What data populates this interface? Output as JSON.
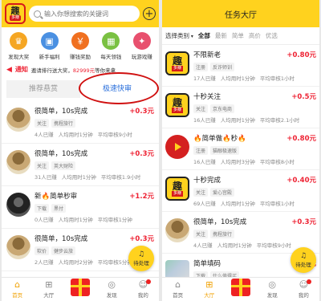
{
  "left": {
    "logo": {
      "char": "趣",
      "tag": "多赚"
    },
    "search": {
      "placeholder": "输入你想搜索的关键词"
    },
    "quick_items": [
      {
        "label": "发现大奖",
        "icon": "trophy-icon",
        "color": "#f5a623",
        "glyph": "♛"
      },
      {
        "label": "新手福利",
        "icon": "gift-icon",
        "color": "#4a90e2",
        "glyph": "▣"
      },
      {
        "label": "赚钱奖励",
        "icon": "coin-icon",
        "color": "#f07020",
        "glyph": "￥"
      },
      {
        "label": "每天领钱",
        "icon": "calendar-icon",
        "color": "#7ac142",
        "glyph": "▦"
      },
      {
        "label": "玩游戏赚",
        "icon": "game-icon",
        "color": "#e8506e",
        "glyph": "✦"
      }
    ],
    "notice": {
      "title": "通知",
      "prefix": "邀请排行送大奖，",
      "highlight": "82999元",
      "suffix": "等你来拿"
    },
    "tabs": [
      "推荐悬赏",
      "极速快审"
    ],
    "tasks": [
      {
        "title": "很简单，10s完成",
        "price": "+0.3元",
        "tags": [
          "关注",
          "携程旅行"
        ],
        "meta": [
          "4人已赚",
          "人均用时1分钟",
          "平均审核9小时"
        ],
        "avatar": "tree"
      },
      {
        "title": "很简单，10s完成",
        "price": "+0.3元",
        "tags": [
          "关注",
          "英大财险"
        ],
        "meta": [
          "31人已赚",
          "人均用时1分钟",
          "平均审核1.9小时"
        ],
        "avatar": "tree"
      },
      {
        "title": "新🔥简单秒审",
        "price": "+1.2元",
        "tags": [
          "下载",
          "黑付"
        ],
        "meta": [
          "0人已赚",
          "人均用时1分钟",
          "平均审核1分钟"
        ],
        "avatar": "dark"
      },
      {
        "title": "很简单，10s完成",
        "price": "+0.3元",
        "tags": [
          "软价",
          "健步云旅"
        ],
        "meta": [
          "2人已赚",
          "人均用时2分钟",
          "平均审核5分钟"
        ],
        "avatar": "tree"
      }
    ],
    "pending": "待处理",
    "nav": [
      {
        "label": "首页",
        "icon": "home-icon",
        "glyph": "⌂",
        "active": true
      },
      {
        "label": "大厅",
        "icon": "grid-icon",
        "glyph": "⊞",
        "active": false
      },
      {
        "label": "",
        "icon": "gift-box-icon",
        "glyph": "",
        "active": false
      },
      {
        "label": "发现",
        "icon": "compass-icon",
        "glyph": "◎",
        "active": false
      },
      {
        "label": "我的",
        "icon": "user-icon",
        "glyph": "☺",
        "active": false
      }
    ]
  },
  "right": {
    "title": "任务大厅",
    "filter_label": "选择类别",
    "filter_tabs": [
      "全部",
      "最新",
      "简单",
      "高价",
      "优选"
    ],
    "tasks": [
      {
        "title": "不限新老",
        "price": "+0.80元",
        "tags": [
          "注册",
          "反诈师训"
        ],
        "meta": [
          "17人已赚",
          "人均用时1分钟",
          "平均审核1小时"
        ],
        "avatar": "logo"
      },
      {
        "title": "十秒关注",
        "price": "+0.5元",
        "tags": [
          "关注",
          "京东电商"
        ],
        "meta": [
          "16人已赚",
          "人均用时1分钟",
          "平均审核2.1小时"
        ],
        "avatar": "logo"
      },
      {
        "title": "🔥简单做🔥秒🔥",
        "price": "+0.80元",
        "tags": [
          "注册",
          "猫眼极速版"
        ],
        "meta": [
          "16人已赚",
          "人均用时3分钟",
          "平均审核8小时"
        ],
        "avatar": "red"
      },
      {
        "title": "十秒完成",
        "price": "+0.40元",
        "tags": [
          "关注",
          "爱心宫殿"
        ],
        "meta": [
          "69人已赚",
          "人均用时1分钟",
          "平均审核1小时"
        ],
        "avatar": "logo"
      },
      {
        "title": "很简单，10s完成",
        "price": "+0.3元",
        "tags": [
          "关注",
          "携程旅行"
        ],
        "meta": [
          "4人已赚",
          "人均用时1分钟",
          "平均审核9小时"
        ],
        "avatar": "tree"
      },
      {
        "title": "简单填码",
        "price": "+0.3元",
        "tags": [
          "下载",
          "什么值得买"
        ],
        "meta": [],
        "avatar": "photo"
      }
    ],
    "pending": "待处理",
    "nav": [
      {
        "label": "首页",
        "icon": "home-icon",
        "glyph": "⌂",
        "active": false
      },
      {
        "label": "大厅",
        "icon": "grid-icon",
        "glyph": "⊞",
        "active": true
      },
      {
        "label": "",
        "icon": "gift-box-icon",
        "glyph": "",
        "active": false
      },
      {
        "label": "发现",
        "icon": "compass-icon",
        "glyph": "◎",
        "active": false
      },
      {
        "label": "我的",
        "icon": "user-icon",
        "glyph": "☺",
        "active": false
      }
    ]
  },
  "colors": {
    "brand_yellow": "#ffd21e",
    "price_red": "#e23",
    "active_blue": "#2a6fdb"
  }
}
